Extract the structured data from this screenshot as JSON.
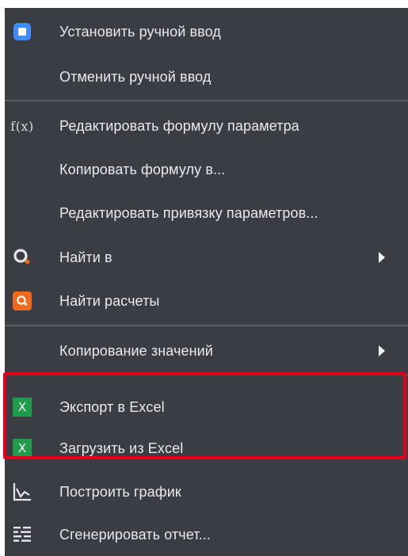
{
  "menu": {
    "items": [
      {
        "label": "Установить ручной ввод",
        "icon": "manual-input-icon"
      },
      {
        "label": "Отменить ручной ввод",
        "icon": ""
      },
      {
        "label": "Редактировать формулу параметра",
        "icon": "formula-fx-icon",
        "icon_text": "f(x)"
      },
      {
        "label": "Копировать формулу в...",
        "icon": ""
      },
      {
        "label": "Редактировать привязку параметров...",
        "icon": ""
      },
      {
        "label": "Найти в",
        "icon": "search-icon",
        "submenu": true
      },
      {
        "label": "Найти расчеты",
        "icon": "search-calculations-icon"
      },
      {
        "label": "Копирование значений",
        "icon": "",
        "submenu": true
      },
      {
        "label": "Экспорт в Excel",
        "icon": "excel-icon",
        "icon_text": "X"
      },
      {
        "label": "Загрузить из Excel",
        "icon": "excel-icon",
        "icon_text": "X"
      },
      {
        "label": "Построить график",
        "icon": "chart-icon"
      },
      {
        "label": "Сгенерировать отчет...",
        "icon": "report-icon"
      }
    ]
  },
  "colors": {
    "menu_background": "#3a3d44",
    "text": "#e9eaec",
    "separator": "#5a5d64",
    "highlight_border": "#e3001b",
    "blue_icon": "#3f8cff",
    "orange_icon": "#f06a1e",
    "green_icon": "#1f9d4a"
  }
}
